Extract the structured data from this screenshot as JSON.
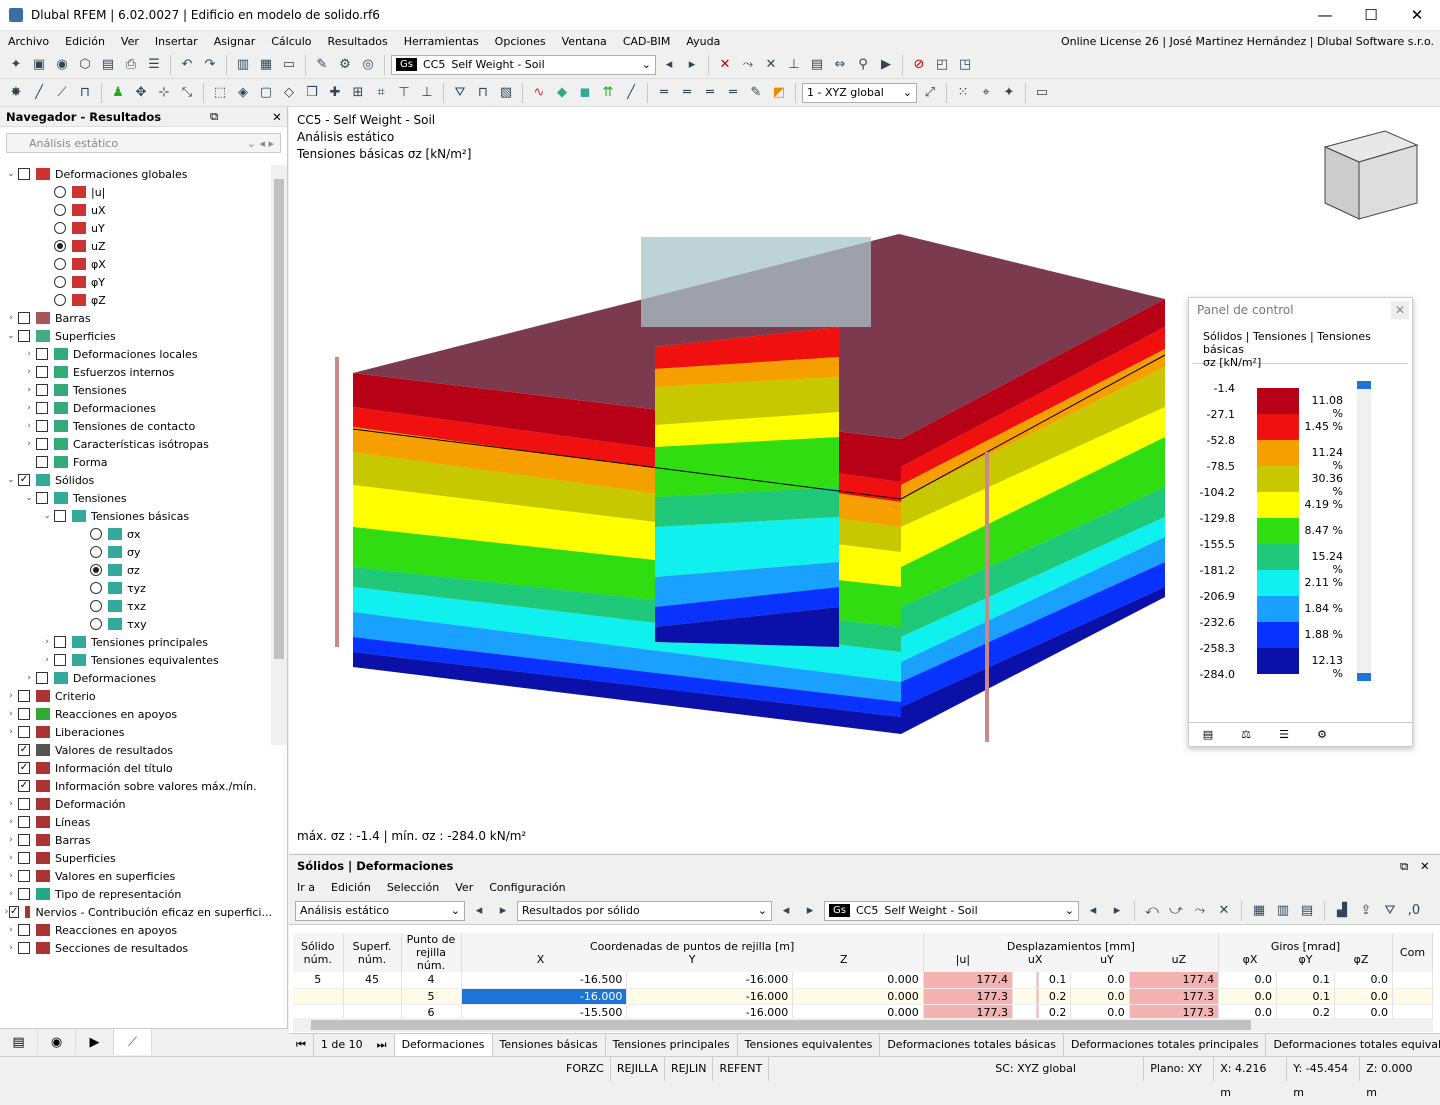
{
  "window": {
    "title": "Dlubal RFEM | 6.02.0027 | Edificio en modelo de solido.rf6",
    "min": "—",
    "max": "☐",
    "close": "✕"
  },
  "menu": {
    "items": [
      "Archivo",
      "Edición",
      "Ver",
      "Insertar",
      "Asignar",
      "Cálculo",
      "Resultados",
      "Herramientas",
      "Opciones",
      "Ventana",
      "CAD-BIM",
      "Ayuda"
    ],
    "license": "Online License 26 | José Martinez Hernández | Dlubal Software s.r.o."
  },
  "toolbar": {
    "lc_tag": "Gs",
    "lc_num": "CC5",
    "lc_name": "Self Weight - Soil",
    "coord": "1 - XYZ global"
  },
  "navigator": {
    "title": "Navegador - Resultados",
    "combo": "Análisis estático",
    "tree": [
      {
        "lvl": 0,
        "exp": "⌄",
        "type": "cb",
        "chk": false,
        "ic": "#c33",
        "label": "Deformaciones globales"
      },
      {
        "lvl": 2,
        "type": "rb",
        "on": false,
        "ic": "#c33",
        "label": "|u|"
      },
      {
        "lvl": 2,
        "type": "rb",
        "on": false,
        "ic": "#c33",
        "label": "uX"
      },
      {
        "lvl": 2,
        "type": "rb",
        "on": false,
        "ic": "#c33",
        "label": "uY"
      },
      {
        "lvl": 2,
        "type": "rb",
        "on": true,
        "ic": "#c33",
        "label": "uZ"
      },
      {
        "lvl": 2,
        "type": "rb",
        "on": false,
        "ic": "#c33",
        "label": "φX"
      },
      {
        "lvl": 2,
        "type": "rb",
        "on": false,
        "ic": "#c33",
        "label": "φY"
      },
      {
        "lvl": 2,
        "type": "rb",
        "on": false,
        "ic": "#c33",
        "label": "φZ"
      },
      {
        "lvl": 0,
        "exp": "›",
        "type": "cb",
        "chk": false,
        "ic": "#a55",
        "label": "Barras"
      },
      {
        "lvl": 0,
        "exp": "⌄",
        "type": "cb",
        "chk": false,
        "ic": "#4a8",
        "label": "Superficies"
      },
      {
        "lvl": 1,
        "exp": "›",
        "type": "cb",
        "chk": false,
        "ic": "#3a7",
        "label": "Deformaciones locales"
      },
      {
        "lvl": 1,
        "exp": "›",
        "type": "cb",
        "chk": false,
        "ic": "#3a7",
        "label": "Esfuerzos internos"
      },
      {
        "lvl": 1,
        "exp": "›",
        "type": "cb",
        "chk": false,
        "ic": "#3a7",
        "label": "Tensiones"
      },
      {
        "lvl": 1,
        "exp": "›",
        "type": "cb",
        "chk": false,
        "ic": "#3a7",
        "label": "Deformaciones"
      },
      {
        "lvl": 1,
        "exp": "›",
        "type": "cb",
        "chk": false,
        "ic": "#3a7",
        "label": "Tensiones de contacto"
      },
      {
        "lvl": 1,
        "exp": "›",
        "type": "cb",
        "chk": false,
        "ic": "#3a7",
        "label": "Características isótropas"
      },
      {
        "lvl": 1,
        "exp": "",
        "type": "cb",
        "chk": false,
        "ic": "#3a7",
        "label": "Forma"
      },
      {
        "lvl": 0,
        "exp": "⌄",
        "type": "cb",
        "chk": true,
        "ic": "#3a9",
        "label": "Sólidos"
      },
      {
        "lvl": 1,
        "exp": "⌄",
        "type": "cb",
        "chk": false,
        "ic": "#3a9",
        "label": "Tensiones"
      },
      {
        "lvl": 2,
        "exp": "⌄",
        "type": "cb",
        "chk": false,
        "ic": "#3a9",
        "label": "Tensiones básicas"
      },
      {
        "lvl": 4,
        "type": "rb",
        "on": false,
        "ic": "#3a9",
        "label": "σx"
      },
      {
        "lvl": 4,
        "type": "rb",
        "on": false,
        "ic": "#3a9",
        "label": "σy"
      },
      {
        "lvl": 4,
        "type": "rb",
        "on": true,
        "ic": "#3a9",
        "label": "σz"
      },
      {
        "lvl": 4,
        "type": "rb",
        "on": false,
        "ic": "#3a9",
        "label": "τyz"
      },
      {
        "lvl": 4,
        "type": "rb",
        "on": false,
        "ic": "#3a9",
        "label": "τxz"
      },
      {
        "lvl": 4,
        "type": "rb",
        "on": false,
        "ic": "#3a9",
        "label": "τxy"
      },
      {
        "lvl": 2,
        "exp": "›",
        "type": "cb",
        "chk": false,
        "ic": "#3a9",
        "label": "Tensiones principales"
      },
      {
        "lvl": 2,
        "exp": "›",
        "type": "cb",
        "chk": false,
        "ic": "#3a9",
        "label": "Tensiones equivalentes"
      },
      {
        "lvl": 1,
        "exp": "›",
        "type": "cb",
        "chk": false,
        "ic": "#3a9",
        "label": "Deformaciones"
      },
      {
        "lvl": 0,
        "exp": "›",
        "type": "cb",
        "chk": false,
        "ic": "#a33",
        "label": "Criterio"
      },
      {
        "lvl": 0,
        "exp": "›",
        "type": "cb",
        "chk": false,
        "ic": "#3a3",
        "label": "Reacciones en apoyos"
      },
      {
        "lvl": 0,
        "exp": "›",
        "type": "cb",
        "chk": false,
        "ic": "#a33",
        "label": "Liberaciones"
      },
      {
        "lvl": 0,
        "exp": "",
        "type": "cb",
        "chk": true,
        "ic": "#555",
        "label": "Valores de resultados"
      },
      {
        "lvl": 0,
        "exp": "",
        "type": "cb",
        "chk": true,
        "ic": "#a33",
        "label": "Información del título"
      },
      {
        "lvl": 0,
        "exp": "",
        "type": "cb",
        "chk": true,
        "ic": "#a33",
        "label": "Información sobre valores máx./mín."
      },
      {
        "lvl": 0,
        "exp": "›",
        "type": "cb",
        "chk": false,
        "ic": "#a33",
        "label": "Deformación"
      },
      {
        "lvl": 0,
        "exp": "›",
        "type": "cb",
        "chk": false,
        "ic": "#a33",
        "label": "Líneas"
      },
      {
        "lvl": 0,
        "exp": "›",
        "type": "cb",
        "chk": false,
        "ic": "#a33",
        "label": "Barras"
      },
      {
        "lvl": 0,
        "exp": "›",
        "type": "cb",
        "chk": false,
        "ic": "#a33",
        "label": "Superficies"
      },
      {
        "lvl": 0,
        "exp": "›",
        "type": "cb",
        "chk": false,
        "ic": "#a33",
        "label": "Valores en superficies"
      },
      {
        "lvl": 0,
        "exp": "›",
        "type": "cb",
        "chk": false,
        "ic": "#2a8",
        "label": "Tipo de representación"
      },
      {
        "lvl": 0,
        "exp": "›",
        "type": "cb",
        "chk": true,
        "ic": "#a33",
        "label": "Nervios - Contribución eficaz en superfici..."
      },
      {
        "lvl": 0,
        "exp": "›",
        "type": "cb",
        "chk": false,
        "ic": "#a33",
        "label": "Reacciones en apoyos"
      },
      {
        "lvl": 0,
        "exp": "›",
        "type": "cb",
        "chk": false,
        "ic": "#a33",
        "label": "Secciones de resultados"
      }
    ]
  },
  "viewport": {
    "line1": "CC5 - Self Weight - Soil",
    "line2": "Análisis estático",
    "line3": "Tensiones básicas σz [kN/m²]",
    "footer": "máx. σz : -1.4 | mín. σz : -284.0 kN/m²"
  },
  "panel": {
    "title": "Panel de control",
    "sub1": "Sólidos | Tensiones | Tensiones básicas",
    "sub2": "σz [kN/m²]",
    "values": [
      "-1.4",
      "-27.1",
      "-52.8",
      "-78.5",
      "-104.2",
      "-129.8",
      "-155.5",
      "-181.2",
      "-206.9",
      "-232.6",
      "-258.3",
      "-284.0"
    ],
    "colors": [
      "#b80016",
      "#f01010",
      "#f5a000",
      "#c8c800",
      "#ffff00",
      "#30dd10",
      "#20c87a",
      "#10f0ee",
      "#1aa0ff",
      "#0a32ff",
      "#0a10a8"
    ],
    "percents": [
      "11.08 %",
      "1.45 %",
      "11.24 %",
      "30.36 %",
      "4.19 %",
      "8.47 %",
      "15.24 %",
      "2.11 %",
      "1.84 %",
      "1.88 %",
      "12.13 %"
    ]
  },
  "bottom": {
    "title": "Sólidos | Deformaciones",
    "menu": [
      "Ir a",
      "Edición",
      "Selección",
      "Ver",
      "Configuración"
    ],
    "combo1": "Análisis estático",
    "combo2": "Resultados por sólido",
    "lc_tag": "Gs",
    "lc_num": "CC5",
    "lc_name": "Self Weight - Soil",
    "h_solid": "Sólido",
    "h_solid2": "núm.",
    "h_surf": "Superf.",
    "h_surf2": "núm.",
    "h_pt": "Punto de",
    "h_pt2": "rejilla núm.",
    "h_coord": "Coordenadas de puntos de rejilla [m]",
    "h_disp": "Desplazamientos [mm]",
    "h_rot": "Giros [mrad]",
    "h_com": "Com",
    "cols": [
      "X",
      "Y",
      "Z",
      "|u|",
      "uX",
      "uY",
      "uZ",
      "φX",
      "φY",
      "φZ"
    ],
    "rows": [
      {
        "solid": "5",
        "surf": "45",
        "pt": "4",
        "x": "-16.500",
        "y": "-16.000",
        "z": "0.000",
        "u": "177.4",
        "ux": "0.1",
        "uy": "0.0",
        "uz": "177.4",
        "px": "0.0",
        "py": "0.1",
        "pz": "0.0"
      },
      {
        "solid": "",
        "surf": "",
        "pt": "5",
        "x": "-16.000",
        "y": "-16.000",
        "z": "0.000",
        "u": "177.3",
        "ux": "0.2",
        "uy": "0.0",
        "uz": "177.3",
        "px": "0.0",
        "py": "0.1",
        "pz": "0.0"
      },
      {
        "solid": "",
        "surf": "",
        "pt": "6",
        "x": "-15.500",
        "y": "-16.000",
        "z": "0.000",
        "u": "177.3",
        "ux": "0.2",
        "uy": "0.0",
        "uz": "177.3",
        "px": "0.0",
        "py": "0.2",
        "pz": "0.0"
      }
    ],
    "page": "1 de 10",
    "tabs": [
      "Deformaciones",
      "Tensiones básicas",
      "Tensiones principales",
      "Tensiones equivalentes",
      "Deformaciones totales básicas",
      "Deformaciones totales principales",
      "Deformaciones totales equivale"
    ]
  },
  "status": [
    "FORZC",
    "REJILLA",
    "REJLIN",
    "REFENT",
    "SC: XYZ global",
    "Plano: XY",
    "X: 4.216 m",
    "Y: -45.454 m",
    "Z: 0.000 m"
  ]
}
